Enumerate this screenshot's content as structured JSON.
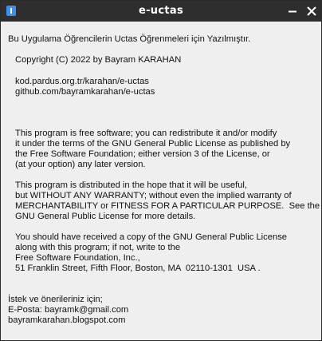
{
  "window": {
    "title": "e-uctas",
    "minimize_glyph": "minimize-icon",
    "close_glyph": "close-icon"
  },
  "about": {
    "intro": "Bu Uygulama Öğrencilerin Uctas Öğrenmeleri için Yazılmıştır.",
    "copyright": "Copyright (C) 2022 by Bayram KARAHAN",
    "links": [
      "kod.pardus.org.tr/karahan/e-uctas",
      "github.com/bayramkarahan/e-uctas"
    ],
    "license": [
      "This program is free software; you can redistribute it and/or modify",
      "it under the terms of the GNU General Public License as published by",
      "the Free Software Foundation; either version 3 of the License, or",
      "(at your option) any later version.",
      "This program is distributed in the hope that it will be useful,",
      "but WITHOUT ANY WARRANTY; without even the implied warranty of",
      "MERCHANTABILITY or FITNESS FOR A PARTICULAR PURPOSE.  See the",
      "GNU General Public License for more details.",
      "You should have received a copy of the GNU General Public License",
      "along with this program; if not, write to the",
      "Free Software Foundation, Inc.,",
      "51 Franklin Street, Fifth Floor, Boston, MA  02110-1301  USA ."
    ],
    "contact": [
      "İstek ve önerileriniz için;",
      "E-Posta: bayramk@gmail.com",
      "bayramkarahan.blogspot.com"
    ]
  },
  "colors": {
    "titlebar": "#2e2e2e",
    "background": "#efefef",
    "icon_accent": "#3d8ff0"
  }
}
